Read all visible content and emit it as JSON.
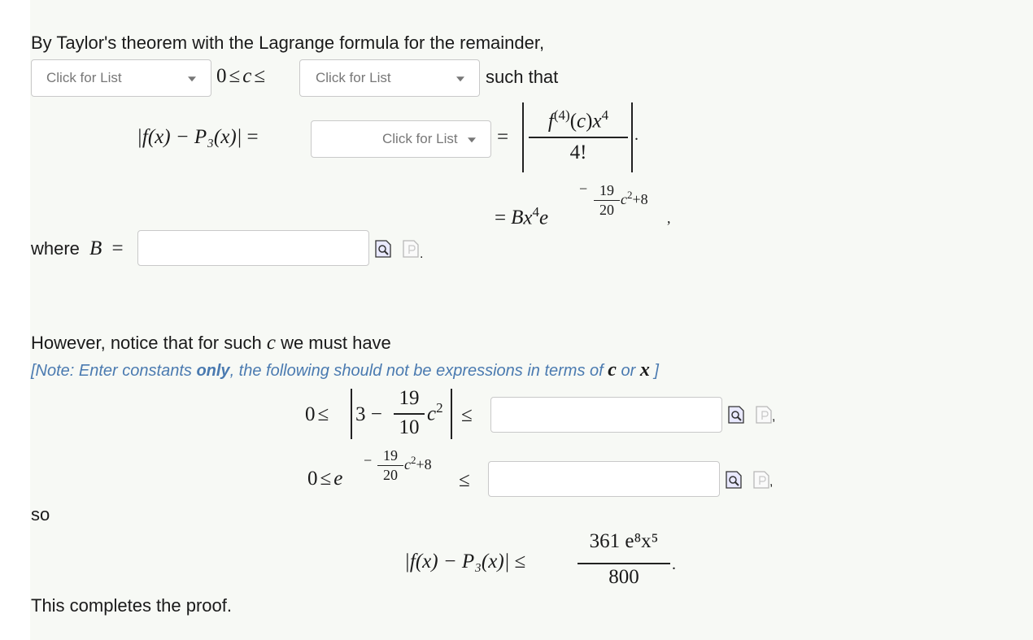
{
  "intro": "By Taylor's theorem with the Lagrange formula for the remainder,",
  "dropdown_label": "Click for List",
  "such_that": "such that",
  "where_label": "where",
  "however": "However, notice that for such",
  "we_must_have": "we must have",
  "note": {
    "prefix": "[Note: Enter constants ",
    "only": "only",
    "middle": ", the following should not be expressions in terms of ",
    "var_c": "c",
    "or": " or ",
    "var_x": "x",
    "suffix": " ]"
  },
  "so": "so",
  "conclusion": "This completes the proof.",
  "math": {
    "zero": "0",
    "leq": "≤",
    "eq": "=",
    "c": "c",
    "B": "B",
    "x": "x",
    "e": "e",
    "lhs": "|f(x) − P₃(x)|",
    "three": "3",
    "minus": "−",
    "num19": "19",
    "den10": "10",
    "den20": "20",
    "plus8": "+8",
    "fourfact": "4!",
    "final_num": "361 e⁸x⁵",
    "final_den": "800"
  },
  "icons": [
    "preview-icon",
    "page-icon"
  ]
}
